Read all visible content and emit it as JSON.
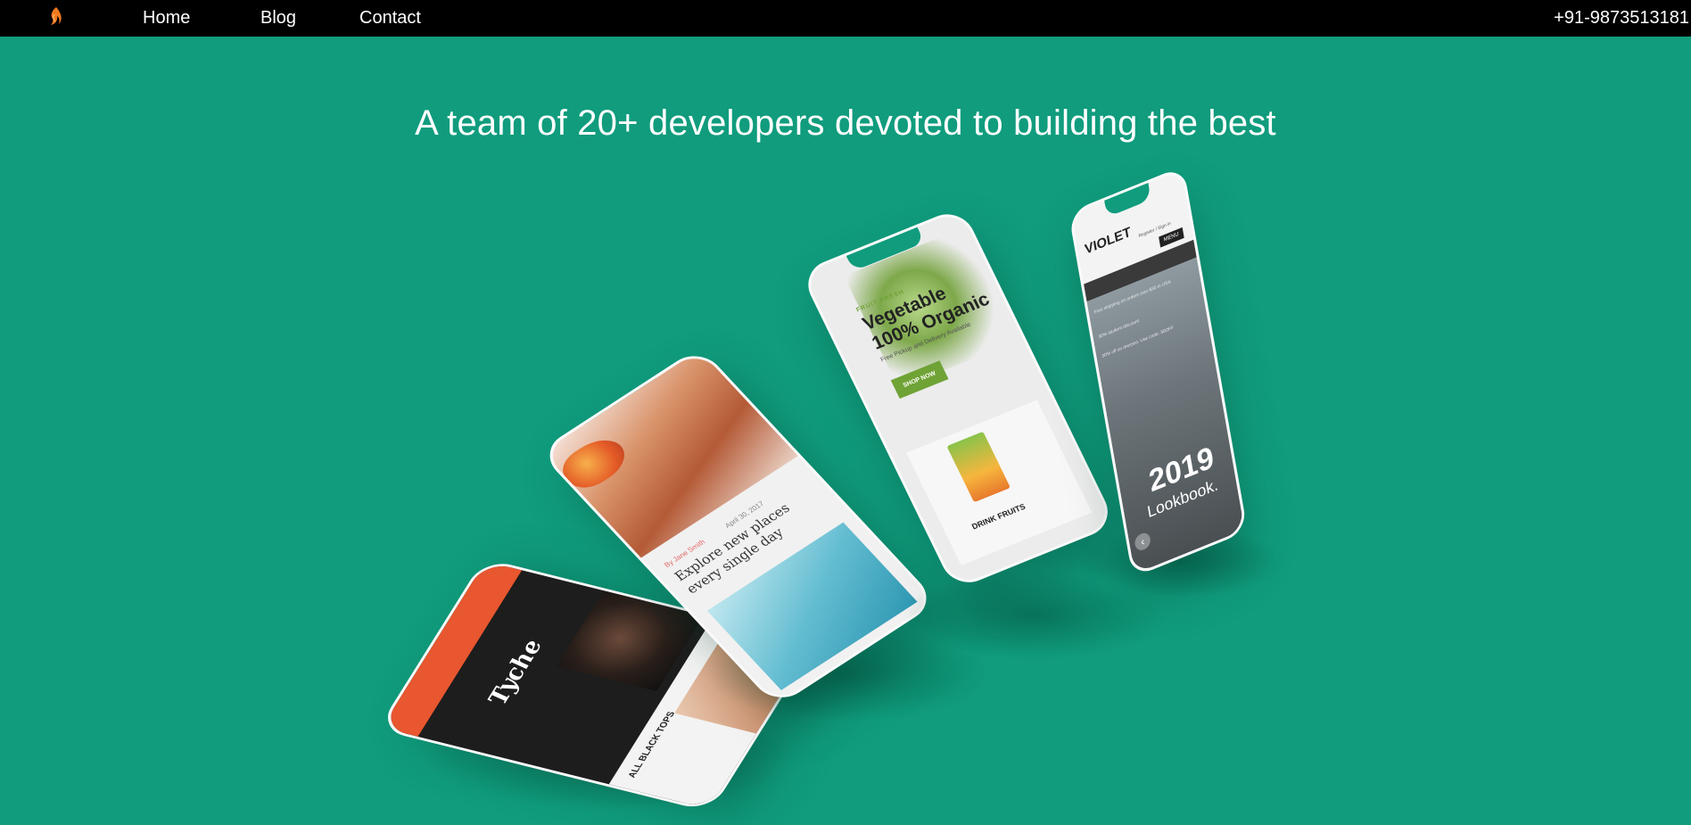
{
  "nav": {
    "logo_icon": "flame-logo-icon",
    "links": [
      {
        "label": "Home"
      },
      {
        "label": "Blog"
      },
      {
        "label": "Contact"
      }
    ],
    "phone": "+91-9873513181"
  },
  "hero": {
    "headline": "A team of 20+ developers devoted to building the best"
  },
  "phones": {
    "tyche": {
      "brand": "Tyche",
      "section_label": "ALL BLACK TOPS"
    },
    "blog": {
      "meta_author": "By Jane Smith",
      "meta_date": "April 30, 2017",
      "title": "Explore new places every single day"
    },
    "grocery": {
      "kicker": "FRUIT FRESH",
      "headline_line1": "Vegetable",
      "headline_line2": "100% Organic",
      "sub": "Free Pickup and Delivery Available",
      "button": "SHOP NOW",
      "product_label": "DRINK FRUITS"
    },
    "violet": {
      "brand": "VIOLET",
      "account": "Register / Sign in",
      "menu": "MENU",
      "promo1": "Free shipping on orders over $30 in USA",
      "promo2": "30% student discount",
      "promo3": "30% off on dresses. Use code: 30OFF",
      "year": "2019",
      "caption": "Lookbook."
    }
  },
  "colors": {
    "background": "#109c7d",
    "nav_bg": "#000000",
    "accent_orange": "#e8572f",
    "grocery_green": "#6fa336"
  }
}
